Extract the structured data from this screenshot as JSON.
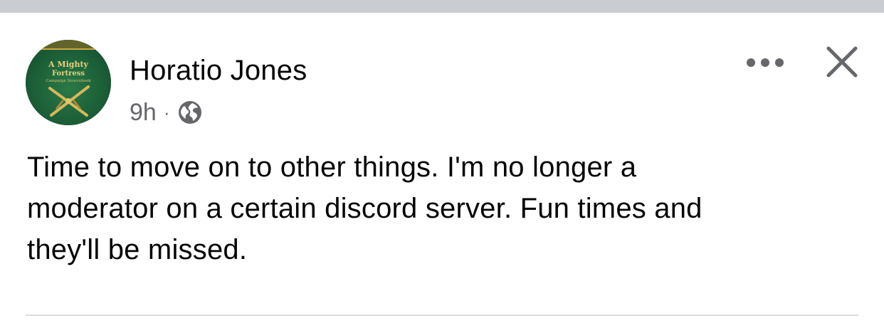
{
  "post": {
    "author": "Horatio Jones",
    "timestamp": "9h",
    "separator": "·",
    "privacy_icon": "globe-icon",
    "text_lines": [
      "Time to move on to other things. I'm no longer a",
      "moderator on a certain discord server. Fun times and",
      "they'll be missed."
    ]
  },
  "avatar": {
    "image_lettering": [
      "A Mighty",
      "Fortress",
      "Campaign Sourcebook"
    ]
  },
  "actions": {
    "more_icon": "more-options-icon",
    "close_icon": "close-icon"
  },
  "colors": {
    "text_primary": "#050505",
    "text_secondary": "#65676b",
    "divider": "#dadde1",
    "top_strip": "#c9ccd1",
    "avatar_green": "#1e6b3c"
  }
}
